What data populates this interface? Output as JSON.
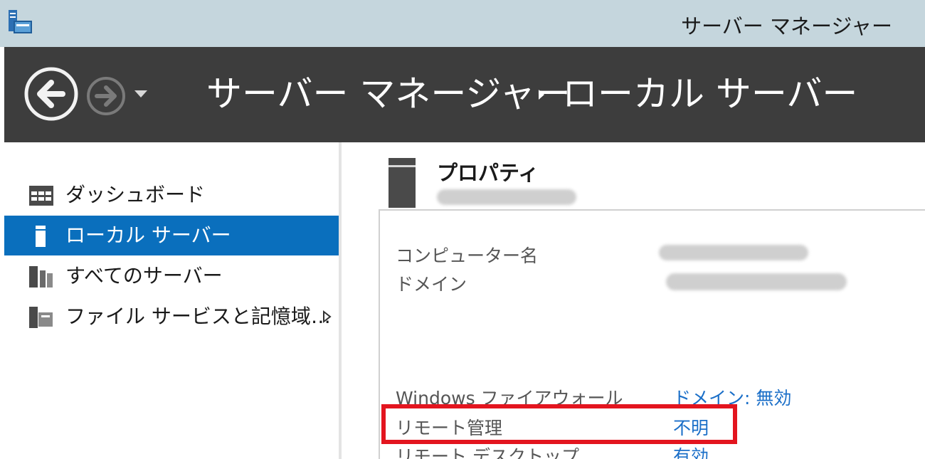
{
  "window": {
    "title": "サーバー マネージャー"
  },
  "header": {
    "breadcrumb_root": "サーバー マネージャー",
    "breadcrumb_current": "ローカル サーバー"
  },
  "sidebar": {
    "items": [
      {
        "label": "ダッシュボード",
        "icon": "dashboard-icon",
        "selected": false
      },
      {
        "label": "ローカル サーバー",
        "icon": "local-server-icon",
        "selected": true
      },
      {
        "label": "すべてのサーバー",
        "icon": "all-servers-icon",
        "selected": false
      },
      {
        "label": "ファイル サービスと記憶域…",
        "icon": "file-storage-icon",
        "selected": false
      }
    ]
  },
  "properties": {
    "title": "プロパティ",
    "rows": [
      {
        "label": "コンピューター名",
        "value": ""
      },
      {
        "label": "ドメイン",
        "value": ""
      },
      {
        "label": "Windows ファイアウォール",
        "value": "ドメイン: 無効"
      },
      {
        "label": "リモート管理",
        "value": "不明"
      },
      {
        "label": "リモート デスクトップ",
        "value": "有効"
      }
    ]
  },
  "colors": {
    "accent": "#0a6fbd",
    "link": "#1b6fc8",
    "highlight": "#e3151f",
    "header_bg": "#3d3d3d",
    "titlebar_bg": "#c5d6dd"
  }
}
